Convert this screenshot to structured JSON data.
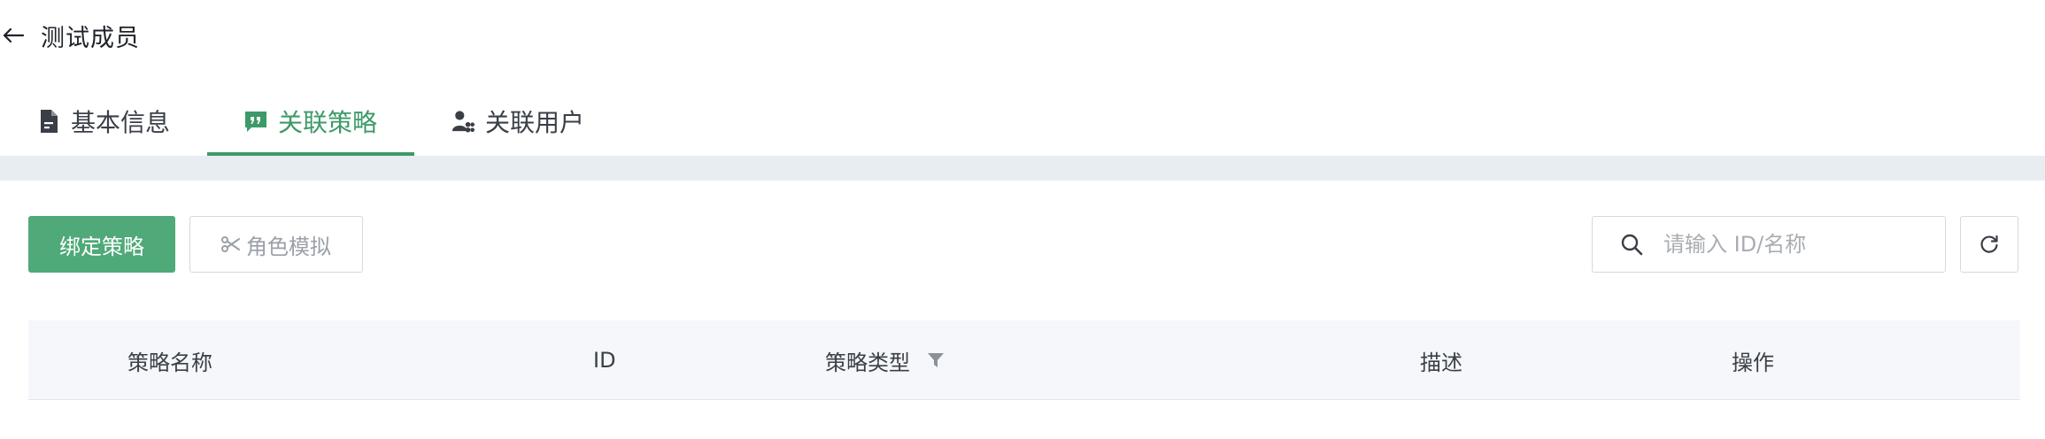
{
  "header": {
    "title": "测试成员",
    "back_icon": "arrow-left-icon"
  },
  "tabs": [
    {
      "label": "基本信息",
      "icon": "document-icon",
      "active": false
    },
    {
      "label": "关联策略",
      "icon": "quote-icon",
      "active": true
    },
    {
      "label": "关联用户",
      "icon": "user-group-icon",
      "active": false
    }
  ],
  "toolbar": {
    "bind_policy_label": "绑定策略",
    "role_simulate_label": "角色模拟",
    "role_simulate_icon": "scissors-icon",
    "search_placeholder": "请输入 ID/名称",
    "search_value": "",
    "search_icon": "search-icon",
    "refresh_icon": "refresh-icon"
  },
  "table": {
    "columns": [
      {
        "label": "策略名称"
      },
      {
        "label": "ID"
      },
      {
        "label": "策略类型",
        "filterable": true
      },
      {
        "label": "描述"
      },
      {
        "label": "操作"
      }
    ],
    "rows": []
  },
  "colors": {
    "accent": "#3d9a69",
    "primary_button": "#4fa978",
    "tab_strip": "#e8edf2",
    "table_header": "#f5f7fa"
  }
}
